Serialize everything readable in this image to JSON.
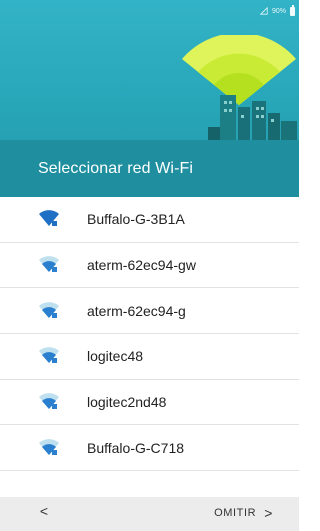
{
  "status": {
    "battery": "90%"
  },
  "header": {
    "title": "Seleccionar red Wi-Fi"
  },
  "networks": [
    {
      "ssid": "Buffalo-G-3B1A",
      "strength": "strong"
    },
    {
      "ssid": "aterm-62ec94-gw",
      "strength": "medium"
    },
    {
      "ssid": "aterm-62ec94-g",
      "strength": "medium"
    },
    {
      "ssid": "logitec48",
      "strength": "medium"
    },
    {
      "ssid": "logitec2nd48",
      "strength": "medium"
    },
    {
      "ssid": "Buffalo-G-C718",
      "strength": "medium"
    }
  ],
  "footer": {
    "back": "<",
    "skip": "OMITIR",
    "skip_chevron": ">"
  },
  "colors": {
    "header": "#2aa9bb",
    "wifi_strong": "#1f6fc4",
    "wifi_weak": "#bfe0ef"
  }
}
